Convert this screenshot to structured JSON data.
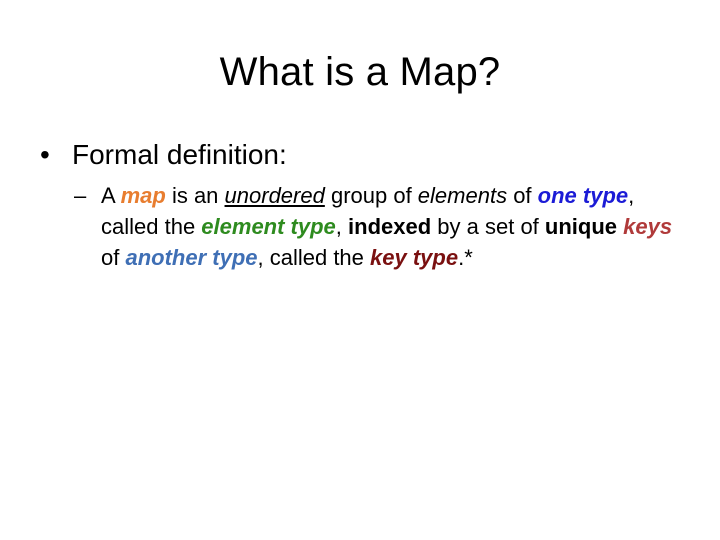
{
  "slide": {
    "title": "What is a Map?",
    "bullet": {
      "marker": "•",
      "text": "Formal definition:"
    },
    "subbullet": {
      "marker": "–",
      "segments": {
        "s01": "A ",
        "s02": "map",
        "s03": " is an ",
        "s04": "unordered",
        "s05": " group of ",
        "s06": "elements",
        "s07": " of ",
        "s08": "one type",
        "s09": ", called the ",
        "s10": "element type",
        "s11": ", ",
        "s12": "indexed",
        "s13": " by a set of ",
        "s14": "unique",
        "s15": " ",
        "s16": "keys",
        "s17": " of ",
        "s18": "another type",
        "s19": ", called the ",
        "s20": "key type",
        "s21": ".*"
      }
    }
  },
  "colors": {
    "map": "#e87d2f",
    "one_type": "#1b1bd6",
    "element_type": "#2e8b1f",
    "keys": "#b03a3a",
    "another_type": "#3f6fb5",
    "key_type": "#7a1010"
  }
}
